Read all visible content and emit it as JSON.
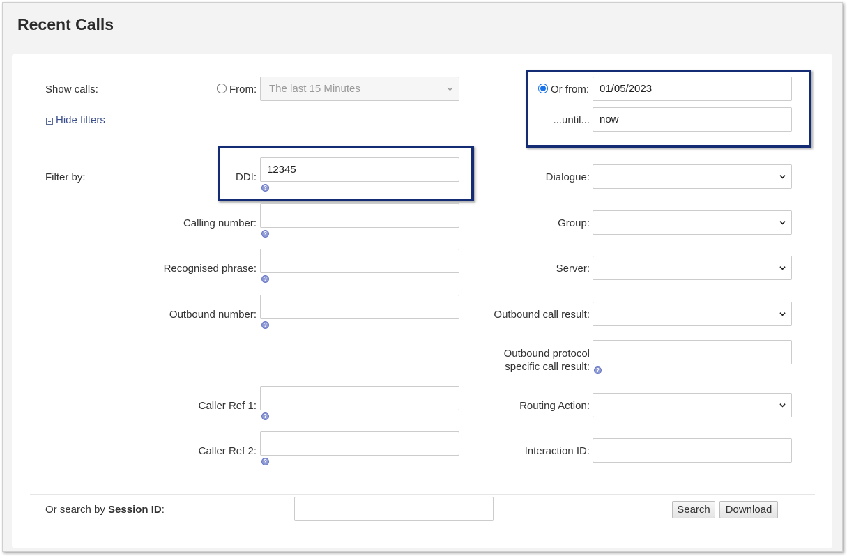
{
  "page": {
    "title": "Recent Calls"
  },
  "show_calls": {
    "label": "Show calls:",
    "from_label": "From:",
    "from_value": "The last 15 Minutes",
    "or_from_label": "Or from:",
    "or_from_value": "01/05/2023",
    "until_label": "...until...",
    "until_value": "now",
    "hide_filters_label": "Hide filters"
  },
  "filters": {
    "label": "Filter by:",
    "ddi": {
      "label": "DDI:",
      "value": "12345"
    },
    "calling_number": {
      "label": "Calling number:",
      "value": ""
    },
    "recognised_phrase": {
      "label": "Recognised phrase:",
      "value": ""
    },
    "outbound_number": {
      "label": "Outbound number:",
      "value": ""
    },
    "caller_ref_1": {
      "label": "Caller Ref 1:",
      "value": ""
    },
    "caller_ref_2": {
      "label": "Caller Ref 2:",
      "value": ""
    },
    "dialogue": {
      "label": "Dialogue:",
      "value": ""
    },
    "group": {
      "label": "Group:",
      "value": ""
    },
    "server": {
      "label": "Server:",
      "value": ""
    },
    "outbound_call_result": {
      "label": "Outbound call result:",
      "value": ""
    },
    "outbound_protocol_line1": "Outbound protocol",
    "outbound_protocol_line2": "specific call result:",
    "outbound_protocol_value": "",
    "routing_action": {
      "label": "Routing Action:",
      "value": ""
    },
    "interaction_id": {
      "label": "Interaction ID:",
      "value": ""
    }
  },
  "session": {
    "label_prefix": "Or search by ",
    "label_bold": "Session ID",
    "label_suffix": ":",
    "value": ""
  },
  "buttons": {
    "search": "Search",
    "download": "Download"
  },
  "help_glyph": "?",
  "colors": {
    "highlight": "#142c73",
    "link": "#3b4f8c",
    "radio_selected": "#1a73e8"
  }
}
